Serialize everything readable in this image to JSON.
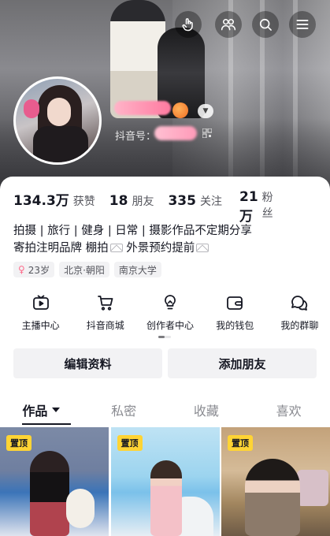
{
  "header": {
    "douyin_id_label": "抖音号：",
    "icons": [
      "hand-pointer-icon",
      "friends-icon",
      "search-icon",
      "menu-icon"
    ]
  },
  "stats": [
    {
      "value": "134.3万",
      "label": "获赞"
    },
    {
      "value": "18",
      "label": "朋友"
    },
    {
      "value": "335",
      "label": "关注"
    },
    {
      "value": "21万",
      "label": "粉丝"
    }
  ],
  "bio": {
    "line1": "拍摄 | 旅行 | 健身 | 日常 | 摄影作品不定期分享",
    "line2_a": "寄拍注明品牌  棚拍",
    "line2_b": "  外景预约提前"
  },
  "tags": {
    "gender_symbol": "♀",
    "age": "23岁",
    "location": "北京·朝阳",
    "school": "南京大学"
  },
  "shortcuts": [
    {
      "label": "主播中心",
      "icon": "tv-icon"
    },
    {
      "label": "抖音商城",
      "icon": "cart-icon"
    },
    {
      "label": "创作者中心",
      "icon": "lightbulb-icon"
    },
    {
      "label": "我的钱包",
      "icon": "wallet-icon"
    },
    {
      "label": "我的群聊",
      "icon": "chat-bubbles-icon"
    }
  ],
  "buttons": {
    "edit_profile": "编辑资料",
    "add_friends": "添加朋友"
  },
  "tabs": [
    {
      "label": "作品",
      "active": true
    },
    {
      "label": "私密",
      "active": false
    },
    {
      "label": "收藏",
      "active": false
    },
    {
      "label": "喜欢",
      "active": false
    }
  ],
  "posts": [
    {
      "pinned_label": "置顶"
    },
    {
      "pinned_label": "置顶"
    },
    {
      "pinned_label": "置顶"
    }
  ],
  "colors": {
    "pin_badge": "#ffd434",
    "text_primary": "#161823",
    "button_bg": "#f2f2f4",
    "gender_pink": "#fe6b8b"
  }
}
